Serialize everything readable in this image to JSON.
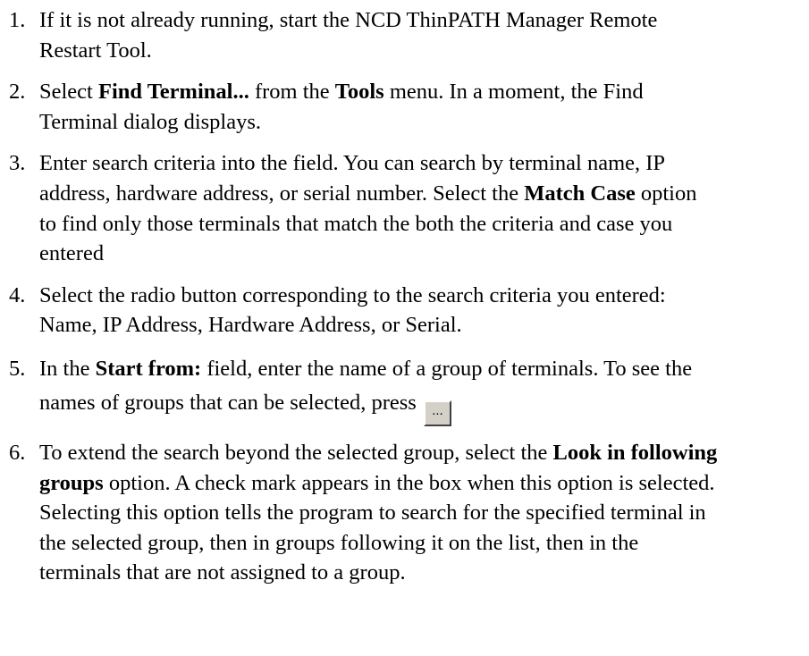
{
  "steps": [
    {
      "num": "1.",
      "text1": "If it is not already running, start the NCD ThinPATH Manager Remote Restart Tool."
    },
    {
      "num": "2.",
      "text1": "Select ",
      "b1": "Find Terminal...",
      "text2": " from the ",
      "b2": "Tools",
      "text3": " menu. In a moment, the Find Terminal dialog displays."
    },
    {
      "num": "3.",
      "text1": "Enter search criteria into the field. You can search by terminal name, IP address, hardware address, or serial number. Select the ",
      "b1": "Match Case",
      "text2": " option to find only those terminals that match the both the criteria and case you entered"
    },
    {
      "num": "4.",
      "text1": "Select the radio button corresponding to the search criteria you entered: Name, IP Address, Hardware Address, or Serial."
    },
    {
      "num": "5.",
      "text1": "In the ",
      "b1": "Start from:",
      "text2": " field, enter the name of a group of terminals. To see the names of groups that can be selected, press",
      "button_label": "..."
    },
    {
      "num": "6.",
      "text1": "To extend the search beyond the selected group, select the ",
      "b1": "Look in following groups",
      "text2": " option. A check mark appears in the box when this option is selected. Selecting this option tells the program to search for the specified terminal in the selected group, then in groups following it on the list, then in the terminals that are not assigned to a group."
    }
  ]
}
